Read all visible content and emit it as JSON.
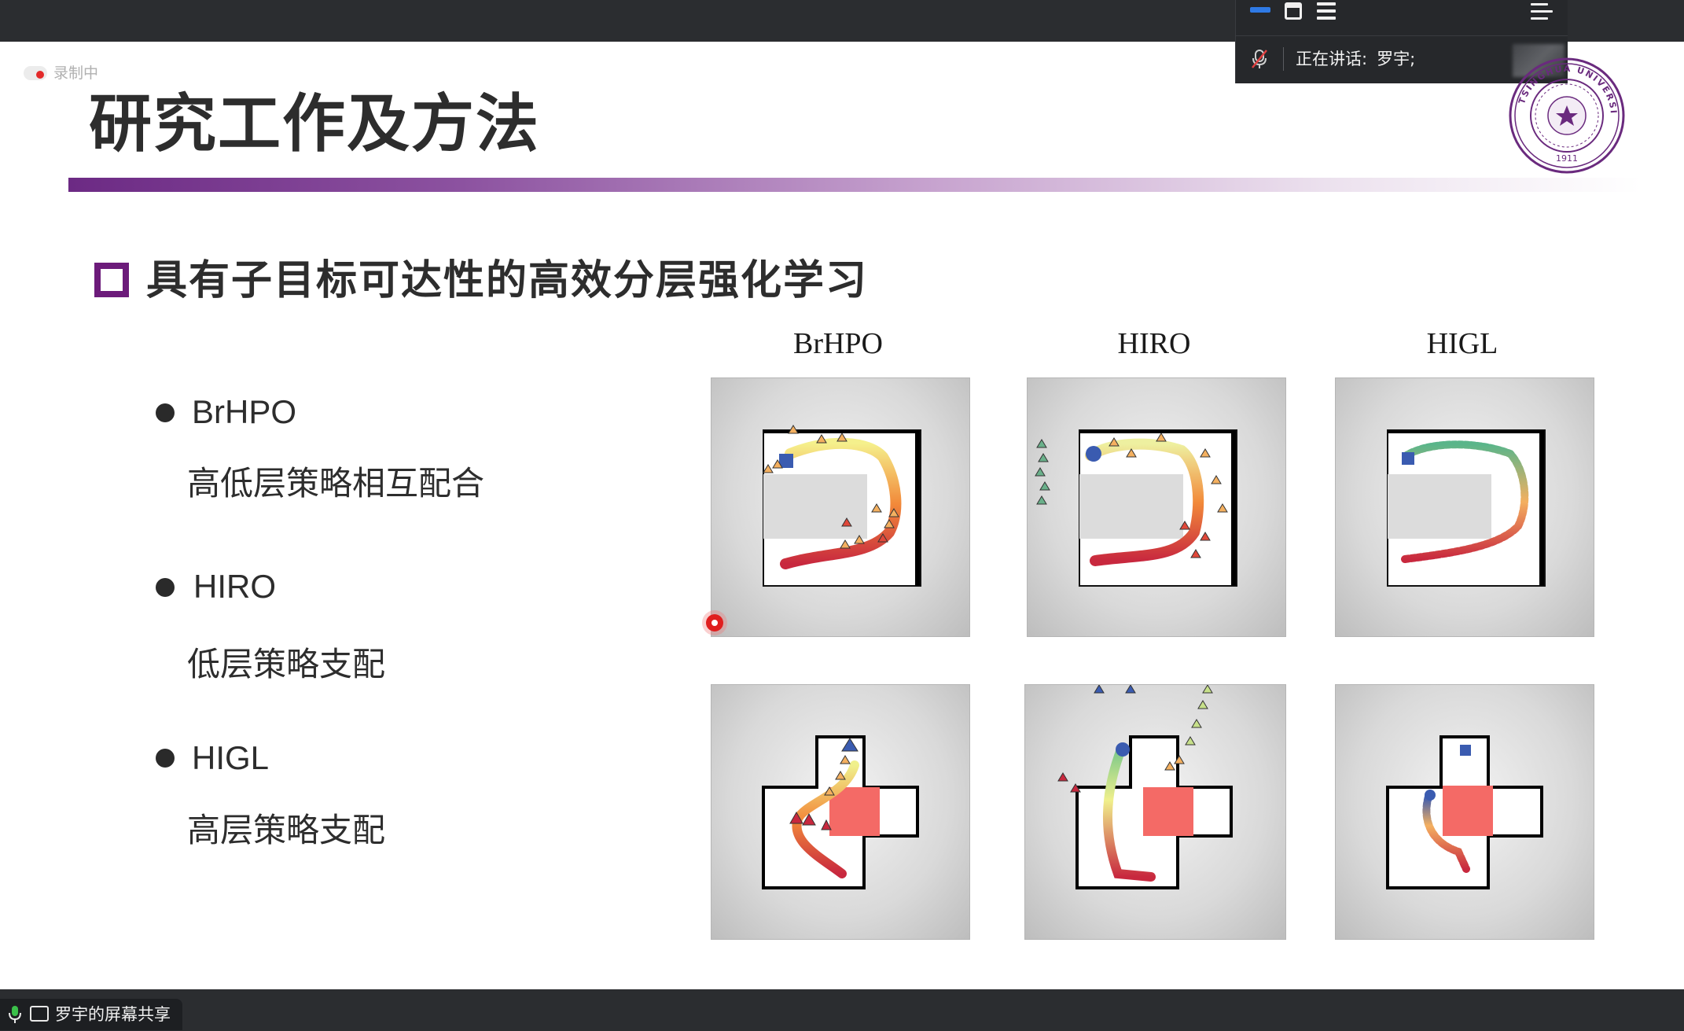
{
  "meeting": {
    "speaking_label": "正在讲话:",
    "speaker": "罗宇;",
    "recording_label": "录制中",
    "share_label": "罗宇的屏幕共享"
  },
  "slide": {
    "title": "研究工作及方法",
    "heading": "具有子目标可达性的高效分层强化学习",
    "items": [
      {
        "name": "BrHPO",
        "desc": "高低层策略相互配合"
      },
      {
        "name": "HIRO",
        "desc": "低层策略支配"
      },
      {
        "name": "HIGL",
        "desc": "高层策略支配"
      }
    ],
    "figure_columns": [
      "BrHPO",
      "HIRO",
      "HIGL"
    ],
    "seal_text": "TSINGHUA UNIVERSITY",
    "seal_year": "1911"
  },
  "colors": {
    "accent_purple": "#6c1b7a",
    "topbar": "#2b2d30",
    "highlight_blue": "#2f7ae5",
    "recording_red": "#e32a2a"
  }
}
